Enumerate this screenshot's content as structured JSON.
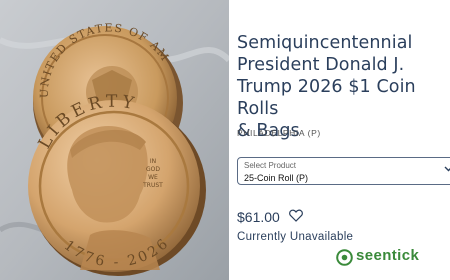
{
  "product": {
    "title_lines": [
      "Semiquincentennial",
      "President Donald J.",
      "Trump 2026 $1 Coin Rolls",
      "& Bags"
    ],
    "mint": "PHILADELPHIA (P)",
    "select_label": "Select Product",
    "select_value": "25-Coin Roll (P)",
    "price": "$61.00",
    "status": "Currently Unavailable"
  },
  "photo": {
    "back_coin_text": "UNITED STATES OF AMERICA",
    "front_coin_top_text": "LIBERTY",
    "front_coin_motto": [
      "IN",
      "GOD",
      "WE",
      "TRUST"
    ],
    "front_coin_bottom_text": "1776 - 2026"
  },
  "watermark": {
    "text": "seentick"
  },
  "icons": {
    "select_chevron": "chevron-down-icon",
    "favorite": "heart-outline-icon",
    "watermark_logo": "eye-logo-icon"
  },
  "colors": {
    "heading": "#2b3f5c",
    "coin_gold": "#c99a5e",
    "watermark_green": "#3a8a3a"
  }
}
